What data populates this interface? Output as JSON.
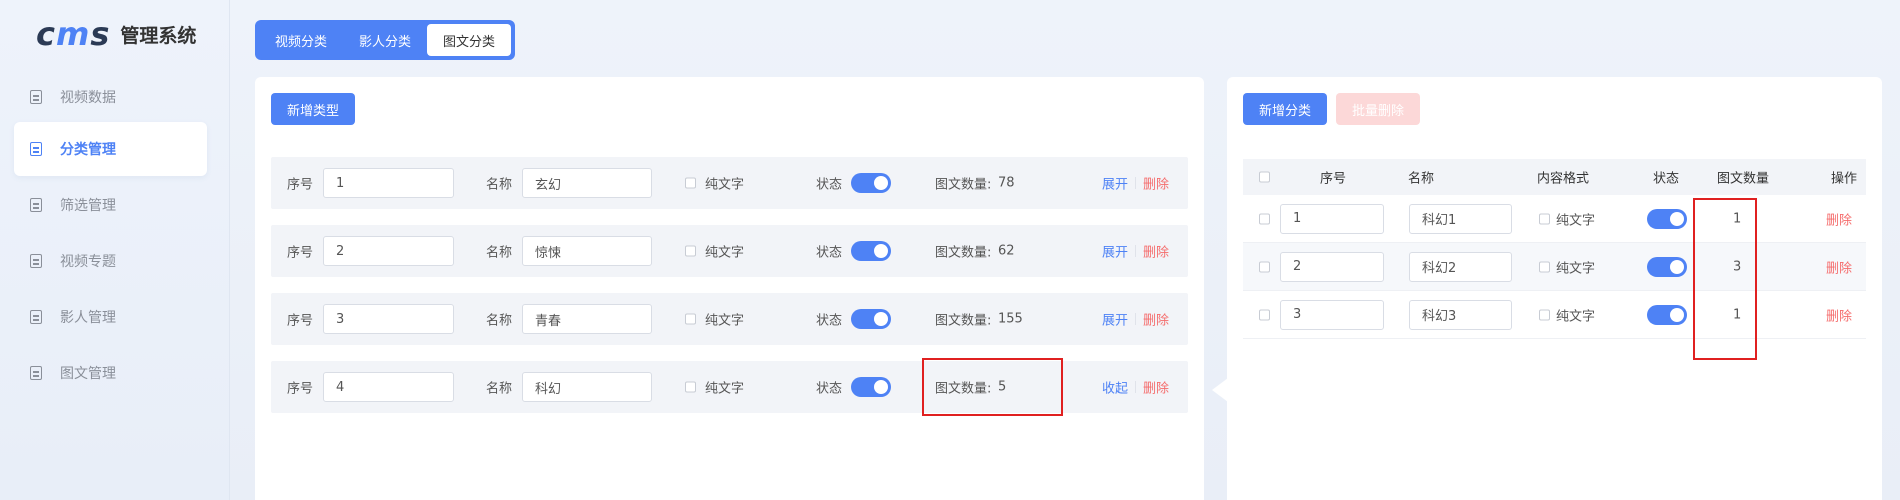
{
  "logo": {
    "mark": "cms",
    "text": "管理系统"
  },
  "sidebar": {
    "items": [
      {
        "label": "视频数据",
        "active": false
      },
      {
        "label": "分类管理",
        "active": true
      },
      {
        "label": "筛选管理",
        "active": false
      },
      {
        "label": "视频专题",
        "active": false
      },
      {
        "label": "影人管理",
        "active": false
      },
      {
        "label": "图文管理",
        "active": false
      }
    ]
  },
  "tabs": [
    {
      "label": "视频分类",
      "active": false
    },
    {
      "label": "影人分类",
      "active": false
    },
    {
      "label": "图文分类",
      "active": true
    }
  ],
  "left_panel": {
    "add_button": "新增类型",
    "labels": {
      "seq": "序号",
      "name": "名称",
      "plain_text": "纯文字",
      "status": "状态",
      "count": "图文数量:",
      "delete": "删除"
    },
    "rows": [
      {
        "seq": "1",
        "name": "玄幻",
        "count": "78",
        "toggle": "展开",
        "status_on": true
      },
      {
        "seq": "2",
        "name": "惊悚",
        "count": "62",
        "toggle": "展开",
        "status_on": true
      },
      {
        "seq": "3",
        "name": "青春",
        "count": "155",
        "toggle": "展开",
        "status_on": true
      },
      {
        "seq": "4",
        "name": "科幻",
        "count": "5",
        "toggle": "收起",
        "status_on": true
      }
    ]
  },
  "right_panel": {
    "add_button": "新增分类",
    "batch_delete_button": "批量删除",
    "columns": {
      "seq": "序号",
      "name": "名称",
      "format": "内容格式",
      "status": "状态",
      "count": "图文数量",
      "action": "操作"
    },
    "plain_text_label": "纯文字",
    "delete_label": "删除",
    "rows": [
      {
        "seq": "1",
        "name": "科幻1",
        "count": "1",
        "status_on": true
      },
      {
        "seq": "2",
        "name": "科幻2",
        "count": "3",
        "status_on": true
      },
      {
        "seq": "3",
        "name": "科幻3",
        "count": "1",
        "status_on": true
      }
    ]
  },
  "colors": {
    "accent": "#4e82f5",
    "danger": "#f56c6c",
    "highlight": "#e02020"
  }
}
